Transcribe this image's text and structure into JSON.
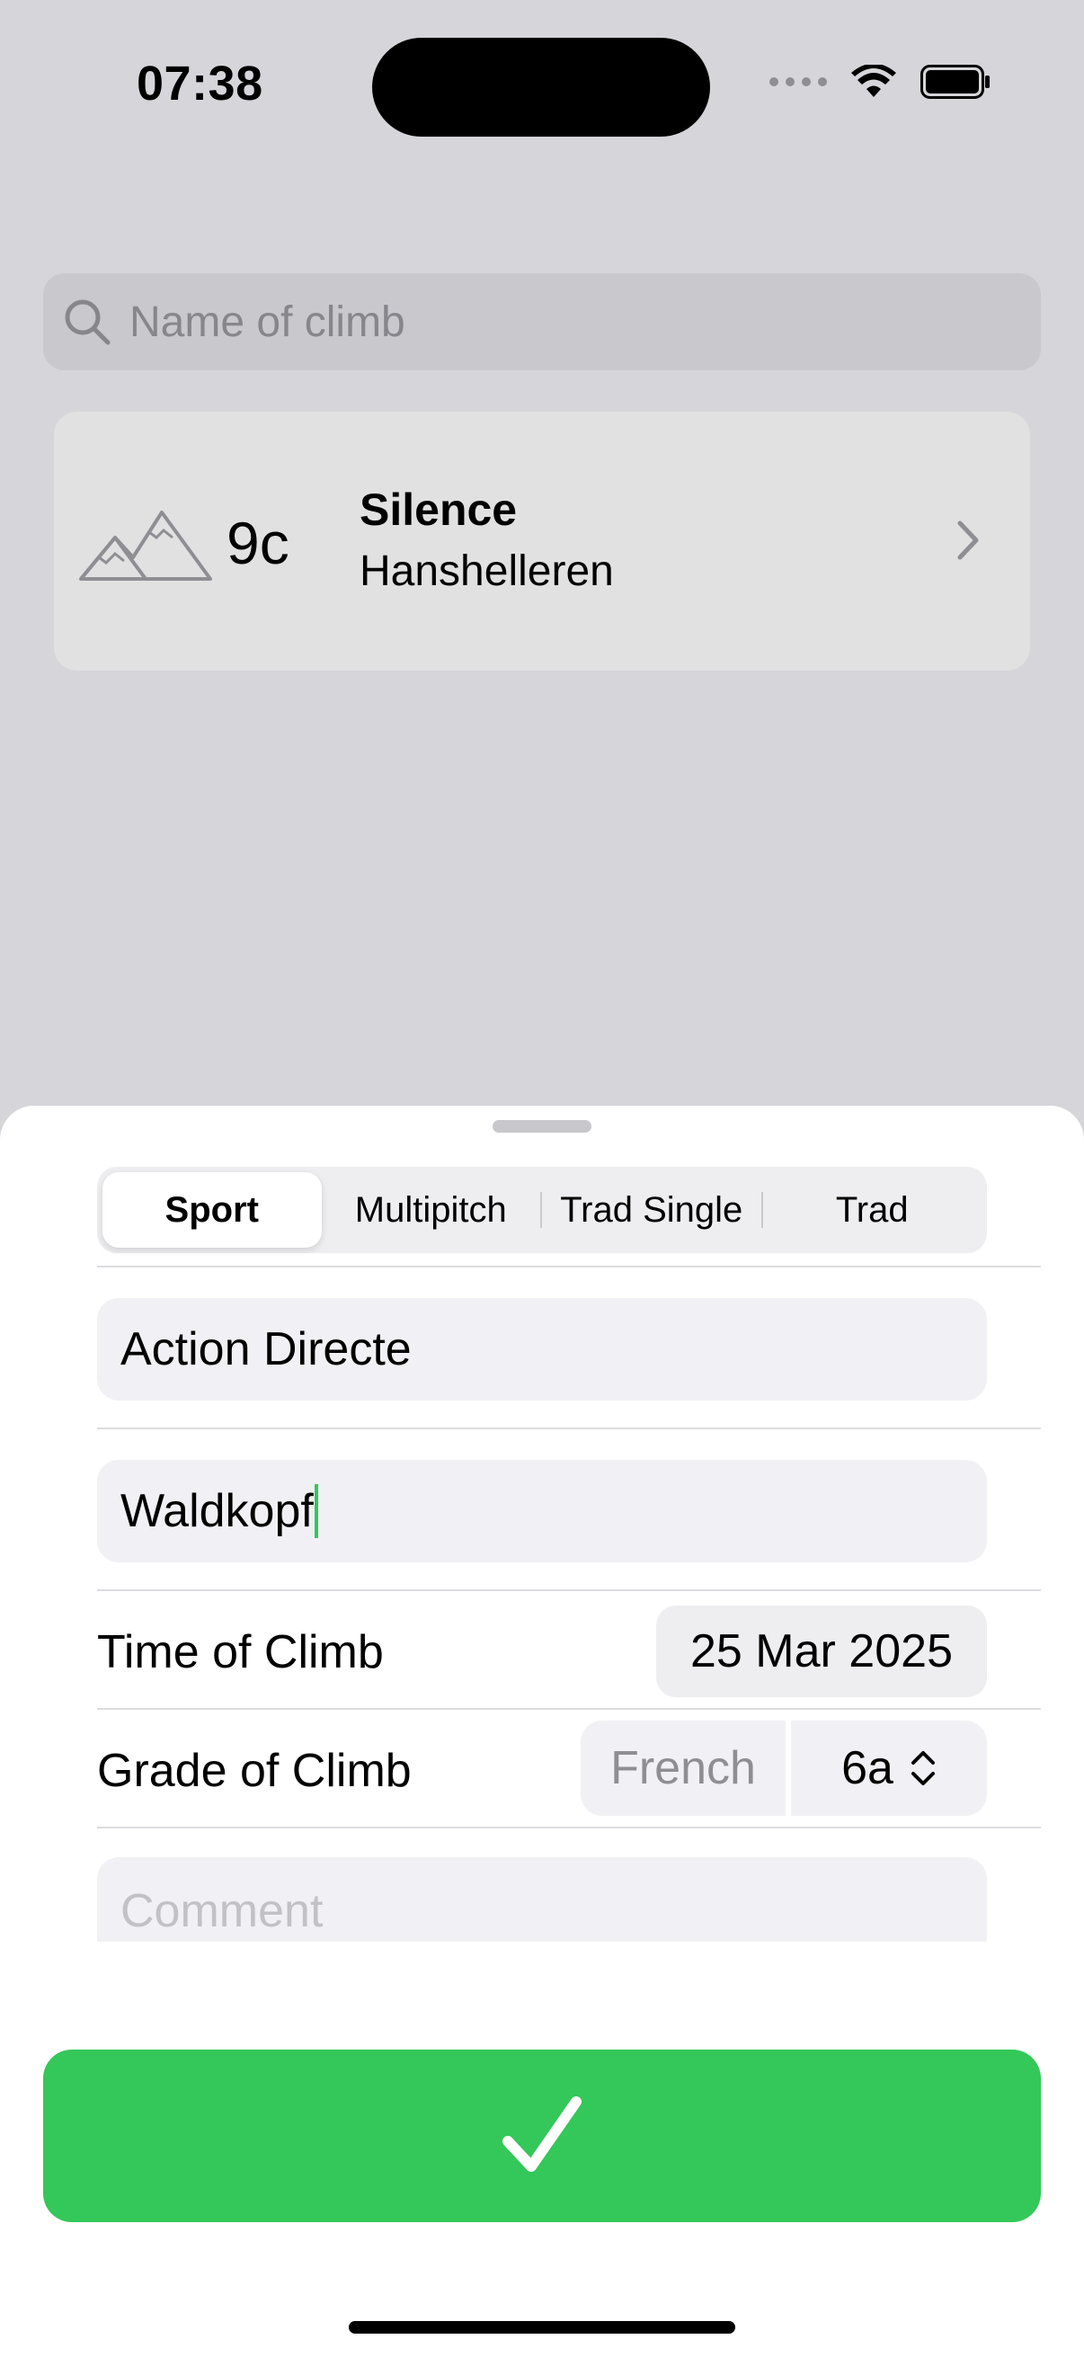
{
  "status_bar": {
    "time": "07:38"
  },
  "search": {
    "placeholder": "Name of climb"
  },
  "climb_list": [
    {
      "grade": "9c",
      "name": "Silence",
      "crag": "Hanshelleren"
    }
  ],
  "sheet": {
    "segments": [
      "Sport",
      "Multipitch",
      "Trad Single",
      "Trad"
    ],
    "selected_segment": "Sport",
    "name_field": "Action Directe",
    "crag_field": "Waldkopf",
    "time_label": "Time of Climb",
    "time_value": "25 Mar 2025",
    "grade_label": "Grade of Climb",
    "grade_system": "French",
    "grade_value": "6a",
    "comment_placeholder": "Comment"
  },
  "icons": {
    "search": "search-icon",
    "mountain": "mountain-icon",
    "chevron": "chevron-right-icon",
    "updown": "chevron-up-down-icon",
    "confirm": "checkmark-icon"
  },
  "colors": {
    "accent_green": "#34c759",
    "dimmed_background": "#d6d5da"
  }
}
